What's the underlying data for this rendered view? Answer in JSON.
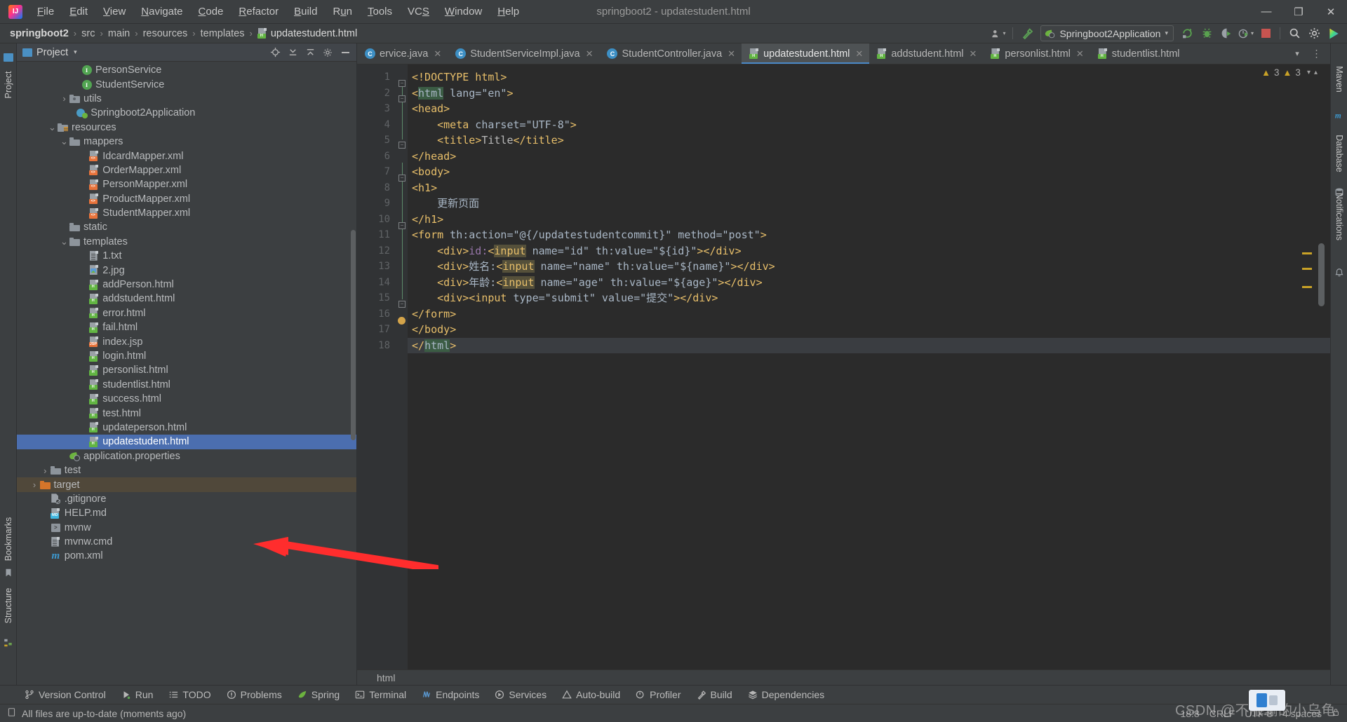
{
  "window": {
    "title": "springboot2 - updatestudent.html",
    "logo_text": "IJ",
    "controls": {
      "minimize": "—",
      "maximize": "❐",
      "close": "✕"
    }
  },
  "menu": [
    {
      "label": "File"
    },
    {
      "label": "Edit"
    },
    {
      "label": "View"
    },
    {
      "label": "Navigate"
    },
    {
      "label": "Code"
    },
    {
      "label": "Refactor"
    },
    {
      "label": "Build"
    },
    {
      "label": "Run"
    },
    {
      "label": "Tools"
    },
    {
      "label": "VCS"
    },
    {
      "label": "Window"
    },
    {
      "label": "Help"
    }
  ],
  "navbar": {
    "crumbs": [
      {
        "label": "springboot2",
        "icon": ""
      },
      {
        "label": "src",
        "icon": ""
      },
      {
        "label": "main",
        "icon": ""
      },
      {
        "label": "resources",
        "icon": ""
      },
      {
        "label": "templates",
        "icon": ""
      },
      {
        "label": "updatestudent.html",
        "icon": "html-file-icon"
      }
    ],
    "separator": "›",
    "run_config": "Springboot2Application",
    "icons": [
      {
        "name": "user-settings-icon"
      },
      {
        "name": "hammer-build-icon"
      },
      {
        "name": "rerun-icon"
      },
      {
        "name": "debug-bug-icon"
      },
      {
        "name": "run-with-coverage-icon"
      },
      {
        "name": "profiler-icon"
      },
      {
        "name": "stop-icon"
      },
      {
        "name": "search-icon"
      },
      {
        "name": "settings-gear-icon"
      },
      {
        "name": "ide-assistant-icon"
      }
    ]
  },
  "left_rail": [
    {
      "label": "Project",
      "icon": "project-icon"
    },
    {
      "label": "Bookmarks",
      "icon": "bookmark-icon"
    },
    {
      "label": "Structure",
      "icon": "structure-icon"
    }
  ],
  "right_rail": [
    {
      "label": "Maven",
      "icon": "maven-icon"
    },
    {
      "label": "Database",
      "icon": "database-icon"
    },
    {
      "label": "Notifications",
      "icon": "bell-icon"
    }
  ],
  "project_panel": {
    "title": "Project",
    "dropdown_icon": "chevron-down-icon",
    "header_icons": [
      {
        "name": "locate-file-icon"
      },
      {
        "name": "expand-all-icon"
      },
      {
        "name": "collapse-all-icon"
      },
      {
        "name": "settings-gear-icon"
      },
      {
        "name": "hide-panel-icon"
      }
    ],
    "tree": [
      {
        "label": "PersonService",
        "indent": 5,
        "arrow": "",
        "icon": "interface-icon",
        "state": ""
      },
      {
        "label": "StudentService",
        "indent": 5,
        "arrow": "",
        "icon": "interface-icon",
        "state": ""
      },
      {
        "label": "utils",
        "indent": 4,
        "arrow": "›",
        "icon": "folder-source-icon",
        "state": ""
      },
      {
        "label": "Springboot2Application",
        "indent": 4.6,
        "arrow": "",
        "icon": "spring-class-icon",
        "state": ""
      },
      {
        "label": "resources",
        "indent": 3,
        "arrow": "⌄",
        "icon": "folder-resources-icon",
        "state": ""
      },
      {
        "label": "mappers",
        "indent": 4,
        "arrow": "⌄",
        "icon": "folder-icon",
        "state": ""
      },
      {
        "label": "IdcardMapper.xml",
        "indent": 5.6,
        "arrow": "",
        "icon": "xml-file-icon",
        "state": ""
      },
      {
        "label": "OrderMapper.xml",
        "indent": 5.6,
        "arrow": "",
        "icon": "xml-file-icon",
        "state": ""
      },
      {
        "label": "PersonMapper.xml",
        "indent": 5.6,
        "arrow": "",
        "icon": "xml-file-icon",
        "state": ""
      },
      {
        "label": "ProductMapper.xml",
        "indent": 5.6,
        "arrow": "",
        "icon": "xml-file-icon",
        "state": ""
      },
      {
        "label": "StudentMapper.xml",
        "indent": 5.6,
        "arrow": "",
        "icon": "xml-file-icon",
        "state": ""
      },
      {
        "label": "static",
        "indent": 4,
        "arrow": "",
        "icon": "folder-icon",
        "state": ""
      },
      {
        "label": "templates",
        "indent": 4,
        "arrow": "⌄",
        "icon": "folder-icon",
        "state": ""
      },
      {
        "label": "1.txt",
        "indent": 5.6,
        "arrow": "",
        "icon": "text-file-icon",
        "state": ""
      },
      {
        "label": "2.jpg",
        "indent": 5.6,
        "arrow": "",
        "icon": "image-file-icon",
        "state": ""
      },
      {
        "label": "addPerson.html",
        "indent": 5.6,
        "arrow": "",
        "icon": "html-file-icon",
        "state": ""
      },
      {
        "label": "addstudent.html",
        "indent": 5.6,
        "arrow": "",
        "icon": "html-file-icon",
        "state": ""
      },
      {
        "label": "error.html",
        "indent": 5.6,
        "arrow": "",
        "icon": "html-file-icon",
        "state": ""
      },
      {
        "label": "fail.html",
        "indent": 5.6,
        "arrow": "",
        "icon": "html-file-icon",
        "state": ""
      },
      {
        "label": "index.jsp",
        "indent": 5.6,
        "arrow": "",
        "icon": "jsp-file-icon",
        "state": ""
      },
      {
        "label": "login.html",
        "indent": 5.6,
        "arrow": "",
        "icon": "html-file-icon",
        "state": ""
      },
      {
        "label": "personlist.html",
        "indent": 5.6,
        "arrow": "",
        "icon": "html-file-icon",
        "state": ""
      },
      {
        "label": "studentlist.html",
        "indent": 5.6,
        "arrow": "",
        "icon": "html-file-icon",
        "state": ""
      },
      {
        "label": "success.html",
        "indent": 5.6,
        "arrow": "",
        "icon": "html-file-icon",
        "state": ""
      },
      {
        "label": "test.html",
        "indent": 5.6,
        "arrow": "",
        "icon": "html-file-icon",
        "state": ""
      },
      {
        "label": "updateperson.html",
        "indent": 5.6,
        "arrow": "",
        "icon": "html-file-icon",
        "state": ""
      },
      {
        "label": "updatestudent.html",
        "indent": 5.6,
        "arrow": "",
        "icon": "html-file-icon",
        "state": "selected"
      },
      {
        "label": "application.properties",
        "indent": 4,
        "arrow": "",
        "icon": "spring-props-icon",
        "state": ""
      },
      {
        "label": "test",
        "indent": 2.4,
        "arrow": "›",
        "icon": "folder-icon",
        "state": ""
      },
      {
        "label": "target",
        "indent": 1.5,
        "arrow": "›",
        "icon": "folder-excluded-icon",
        "state": "hl"
      },
      {
        "label": ".gitignore",
        "indent": 2.4,
        "arrow": "",
        "icon": "gitignore-file-icon",
        "state": ""
      },
      {
        "label": "HELP.md",
        "indent": 2.4,
        "arrow": "",
        "icon": "markdown-file-icon",
        "state": ""
      },
      {
        "label": "mvnw",
        "indent": 2.4,
        "arrow": "",
        "icon": "script-file-icon",
        "state": ""
      },
      {
        "label": "mvnw.cmd",
        "indent": 2.4,
        "arrow": "",
        "icon": "text-file-icon",
        "state": ""
      },
      {
        "label": "pom.xml",
        "indent": 2.4,
        "arrow": "",
        "icon": "maven-pom-icon",
        "state": ""
      }
    ]
  },
  "editor": {
    "tabs": [
      {
        "label": "ervice.java",
        "icon": "java-class-icon",
        "active": false,
        "close": "✕"
      },
      {
        "label": "StudentServiceImpl.java",
        "icon": "java-class-icon",
        "active": false,
        "close": "✕"
      },
      {
        "label": "StudentController.java",
        "icon": "java-class-icon",
        "active": false,
        "close": "✕"
      },
      {
        "label": "updatestudent.html",
        "icon": "html-file-icon",
        "active": true,
        "close": "✕"
      },
      {
        "label": "addstudent.html",
        "icon": "html-file-icon",
        "active": false,
        "close": "✕"
      },
      {
        "label": "personlist.html",
        "icon": "html-file-icon",
        "active": false,
        "close": "✕"
      },
      {
        "label": "studentlist.html",
        "icon": "html-file-icon",
        "active": false,
        "close": ""
      }
    ],
    "tabs_overflow_icon": "chevron-down-icon",
    "tabs_more_icon": "more-options-icon",
    "inspection": {
      "warning_icon": "warning-triangle-icon",
      "warning_count": "3",
      "error_icon": "warning-triangle-icon",
      "error_count": "3",
      "collapse_icon": "chevron-down-icon",
      "expand_icon": "chevron-up-icon"
    },
    "line_numbers": [
      "1",
      "2",
      "3",
      "4",
      "5",
      "6",
      "7",
      "8",
      "9",
      "10",
      "11",
      "12",
      "13",
      "14",
      "15",
      "16",
      "17",
      "18"
    ],
    "lines": [
      {
        "n": 1,
        "raw": "<!DOCTYPE html>"
      },
      {
        "n": 2,
        "raw": "<html lang=\"en\">"
      },
      {
        "n": 3,
        "raw": "<head>"
      },
      {
        "n": 4,
        "raw": "    <meta charset=\"UTF-8\">"
      },
      {
        "n": 5,
        "raw": "    <title>Title</title>"
      },
      {
        "n": 6,
        "raw": "</head>"
      },
      {
        "n": 7,
        "raw": "<body>"
      },
      {
        "n": 8,
        "raw": "<h1>"
      },
      {
        "n": 9,
        "raw": "    更新页面"
      },
      {
        "n": 10,
        "raw": "</h1>"
      },
      {
        "n": 11,
        "raw": "<form th:action=\"@{/updatestudentcommit}\" method=\"post\">"
      },
      {
        "n": 12,
        "raw": "    <div>id:<input name=\"id\" th:value=\"${id}\"></div>"
      },
      {
        "n": 13,
        "raw": "    <div>姓名:<input name=\"name\" th:value=\"${name}\"></div>"
      },
      {
        "n": 14,
        "raw": "    <div>年龄:<input name=\"age\" th:value=\"${age}\"></div>"
      },
      {
        "n": 15,
        "raw": "    <div><input type=\"submit\" value=\"提交\"></div>"
      },
      {
        "n": 16,
        "raw": "</form>"
      },
      {
        "n": 17,
        "raw": "</body>"
      },
      {
        "n": 18,
        "raw": "</html>"
      }
    ],
    "breadcrumb": "html"
  },
  "tool_windows": [
    {
      "label": "Version Control",
      "icon": "branch-icon"
    },
    {
      "label": "Run",
      "icon": "run-play-icon"
    },
    {
      "label": "TODO",
      "icon": "todo-list-icon"
    },
    {
      "label": "Problems",
      "icon": "problems-icon"
    },
    {
      "label": "Spring",
      "icon": "spring-leaf-icon"
    },
    {
      "label": "Terminal",
      "icon": "terminal-icon"
    },
    {
      "label": "Endpoints",
      "icon": "endpoints-icon"
    },
    {
      "label": "Services",
      "icon": "services-icon"
    },
    {
      "label": "Auto-build",
      "icon": "auto-build-icon"
    },
    {
      "label": "Profiler",
      "icon": "profiler-icon"
    },
    {
      "label": "Build",
      "icon": "hammer-build-icon"
    },
    {
      "label": "Dependencies",
      "icon": "dependencies-icon"
    }
  ],
  "status_bar": {
    "message_icon": "document-icon",
    "message": "All files are up-to-date (moments ago)",
    "caret_position": "18:8",
    "line_separator": "CRLF",
    "encoding": "UTF-8",
    "indent": "4 spaces",
    "lock_icon": "lock-icon"
  },
  "watermark": {
    "text": "CSDN @不服输的小乌龟"
  },
  "colors": {
    "selection_blue": "#4b6eaf",
    "accent_tab": "#4a88c7",
    "html_badge_green": "#62b543",
    "xml_badge_orange": "#e8733b",
    "excluded_orange": "#d4752a",
    "annotation_red": "#ff2d2d",
    "editor_bg": "#2b2b2b",
    "panel_bg": "#3c3f41"
  }
}
